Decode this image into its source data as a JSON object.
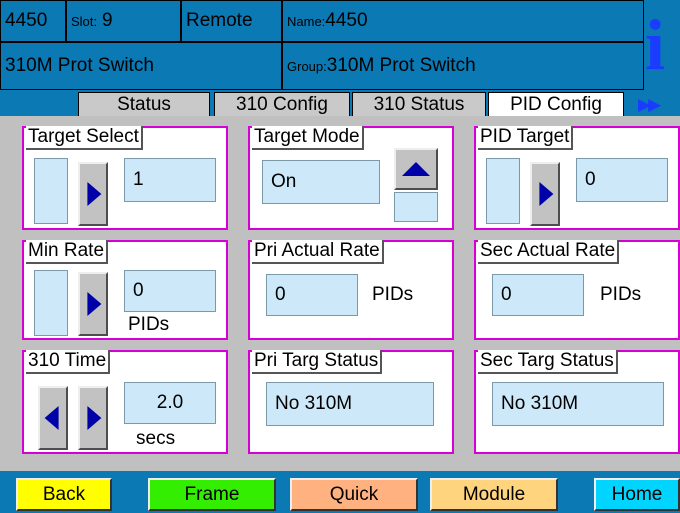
{
  "header": {
    "id": "4450",
    "slot_label": "Slot:",
    "slot_value": "9",
    "mode": "Remote",
    "name_label": "Name:",
    "name_value": "4450",
    "device": "310M Prot Switch",
    "group_label": "Group:",
    "group_value": "310M Prot Switch",
    "info_glyph": "i"
  },
  "tabs": [
    {
      "label": "Status",
      "active": false
    },
    {
      "label": "310 Config",
      "active": false
    },
    {
      "label": "310 Status",
      "active": false
    },
    {
      "label": "PID Config",
      "active": true
    }
  ],
  "tab_more": "▶▶",
  "panels": {
    "target_select": {
      "title": "Target Select",
      "value": "1"
    },
    "target_mode": {
      "title": "Target Mode",
      "value": "On"
    },
    "pid_target": {
      "title": "PID Target",
      "value": "0"
    },
    "min_rate": {
      "title": "Min Rate",
      "value": "0",
      "unit": "PIDs"
    },
    "pri_actual_rate": {
      "title": "Pri Actual Rate",
      "value": "0",
      "unit": "PIDs"
    },
    "sec_actual_rate": {
      "title": "Sec Actual Rate",
      "value": "0",
      "unit": "PIDs"
    },
    "time_310": {
      "title": "310 Time",
      "value": "2.0",
      "unit": "secs"
    },
    "pri_targ_status": {
      "title": "Pri Targ Status",
      "value": "No 310M"
    },
    "sec_targ_status": {
      "title": "Sec Targ Status",
      "value": "No 310M"
    }
  },
  "footer": {
    "back": "Back",
    "frame": "Frame",
    "quick": "Quick",
    "module": "Module",
    "home": "Home"
  },
  "colors": {
    "header_blue": "#0a79b4",
    "panel_border": "#d600d6",
    "field_bg": "#cde9f9",
    "arrow_blue": "#0000a8",
    "info_blue": "#1a3cff",
    "back_yellow": "#ffff00",
    "frame_green": "#33ee00",
    "quick_orange": "#ffb27f",
    "module_tan": "#ffd47f",
    "home_cyan": "#00d4ff"
  }
}
